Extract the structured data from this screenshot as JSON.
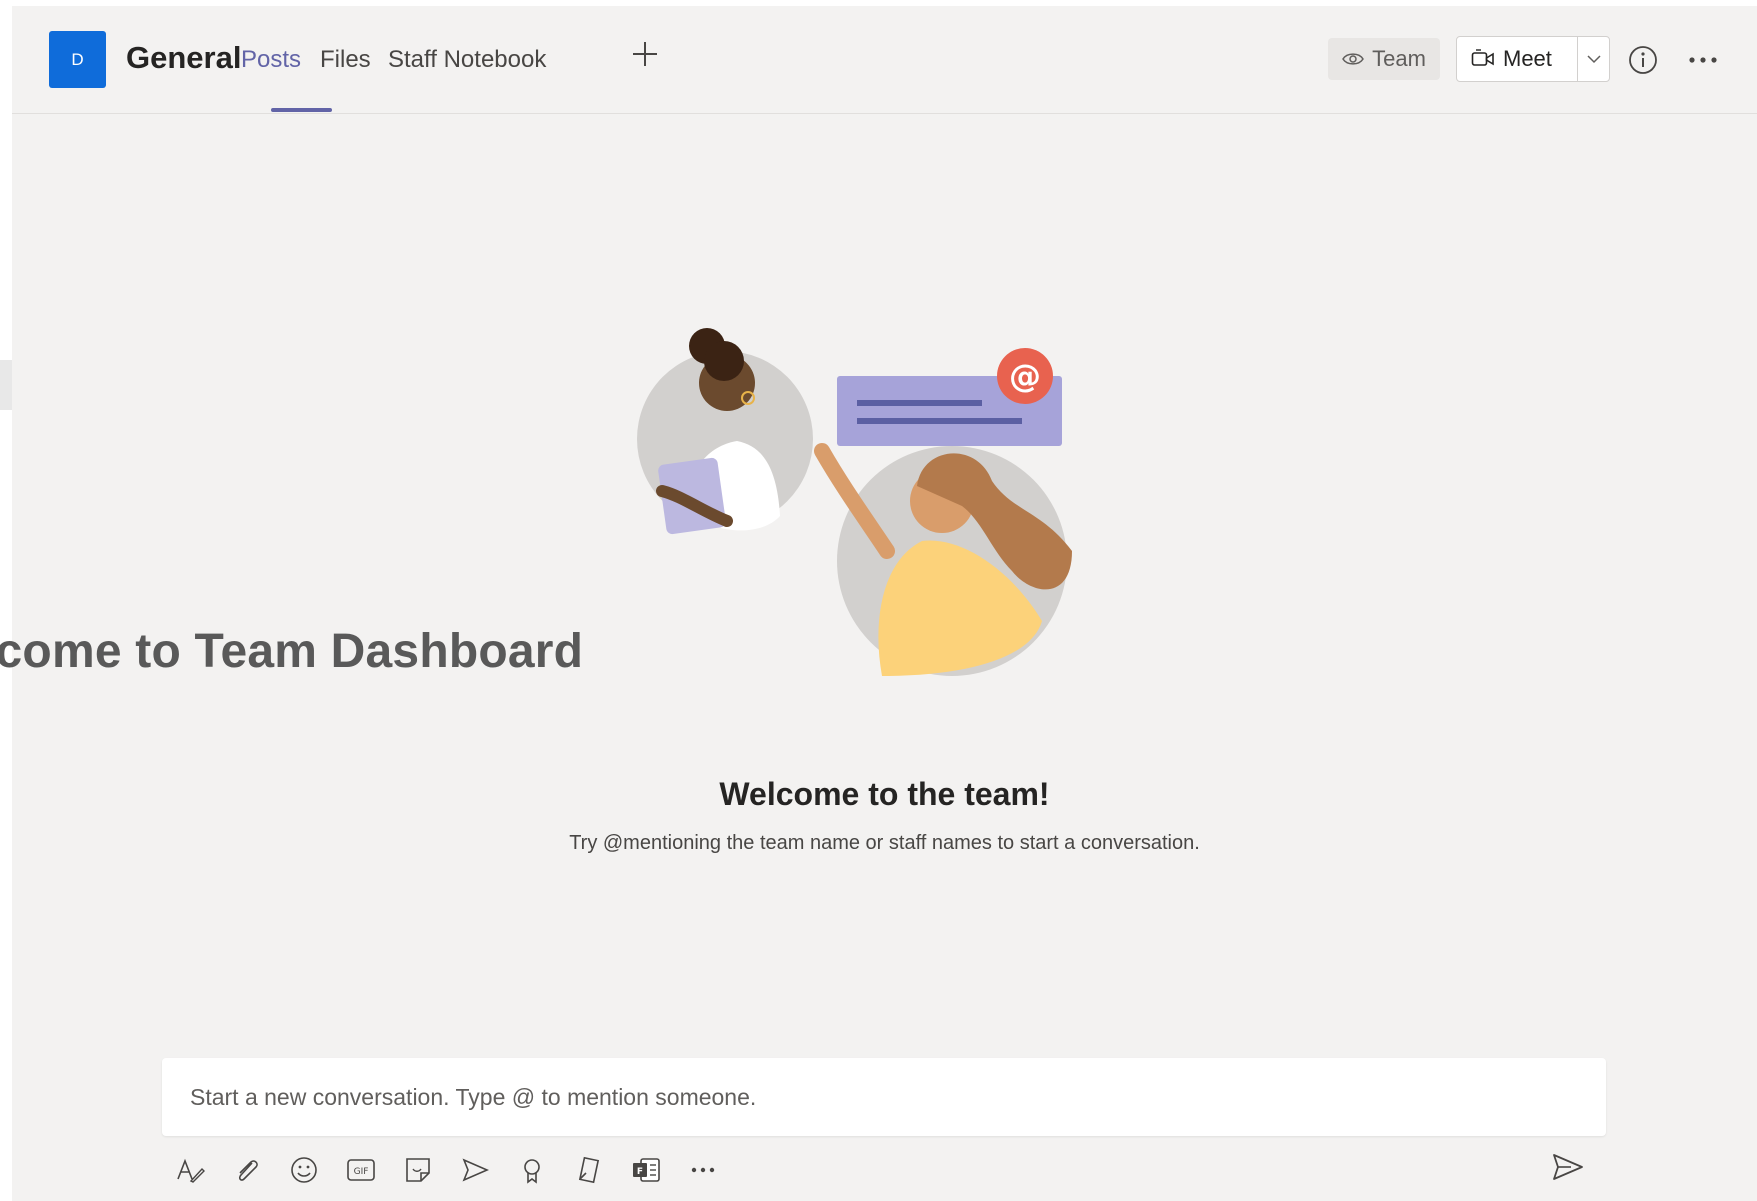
{
  "header": {
    "avatar_initial": "D",
    "channel_name": "General",
    "tabs": [
      {
        "label": "Posts",
        "active": true
      },
      {
        "label": "Files",
        "active": false
      },
      {
        "label": "Staff Notebook",
        "active": false
      }
    ],
    "team_button_label": "Team",
    "meet_button_label": "Meet"
  },
  "main": {
    "welcome_title": "Welcome to the team!",
    "welcome_subtitle": "Try @mentioning the team name or staff names to start a conversation.",
    "overlay_heading": "lcome to  Team Dashboard"
  },
  "compose": {
    "placeholder": "Start a new conversation. Type @ to mention someone."
  },
  "toolbar_icons": [
    "format-icon",
    "attach-icon",
    "emoji-icon",
    "gif-icon",
    "sticker-icon",
    "meet-now-icon",
    "praise-icon",
    "approvals-icon",
    "forms-icon",
    "more-options-icon",
    "send-icon"
  ],
  "colors": {
    "accent": "#6264a7",
    "avatar": "#0f6cda",
    "mention_badge": "#e8624f",
    "background": "#f3f2f1"
  }
}
